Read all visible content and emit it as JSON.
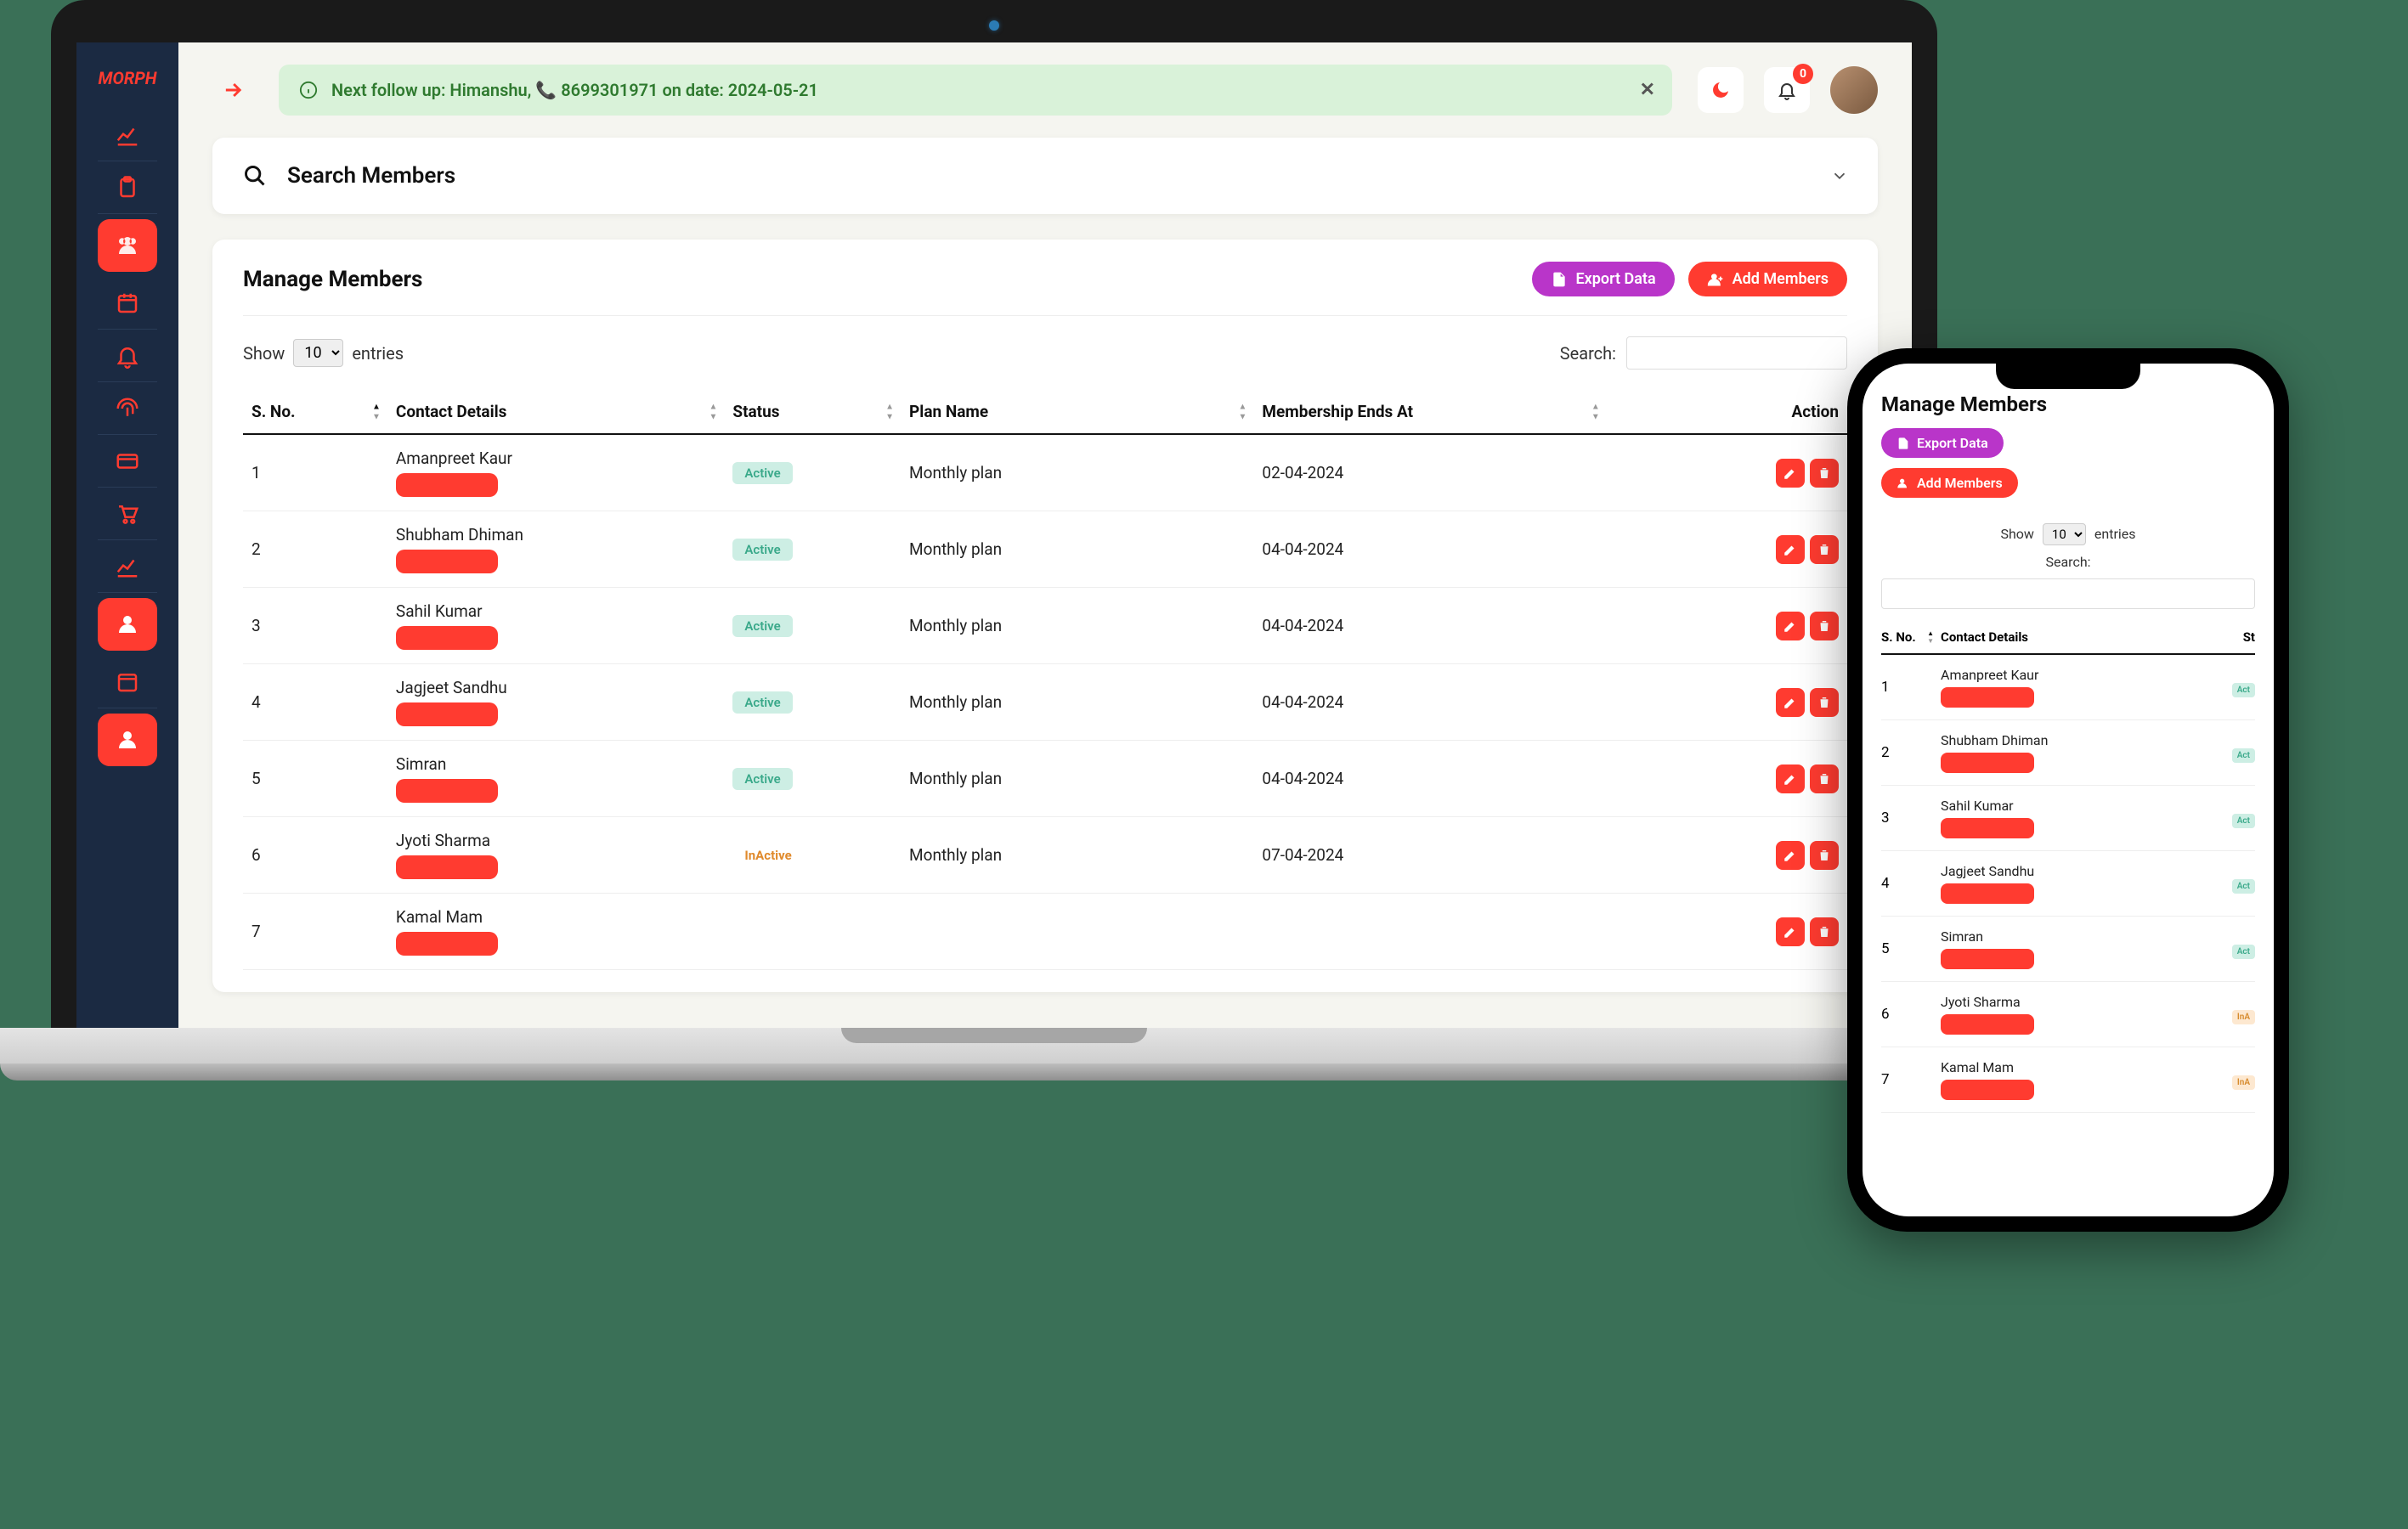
{
  "logo": "MORPH",
  "alert": {
    "text": "Next follow up: Himanshu, 📞 8699301971 on date: 2024-05-21"
  },
  "notifications": {
    "count": "0"
  },
  "search_card": {
    "title": "Search Members"
  },
  "manage": {
    "title": "Manage Members",
    "export_label": "Export Data",
    "add_label": "Add Members"
  },
  "table": {
    "show_prefix": "Show",
    "show_value": "10",
    "show_suffix": "entries",
    "search_label": "Search:",
    "columns": {
      "sno": "S. No.",
      "contact": "Contact Details",
      "status": "Status",
      "plan": "Plan Name",
      "ends": "Membership Ends At",
      "action": "Action"
    },
    "rows": [
      {
        "no": "1",
        "name": "Amanpreet Kaur",
        "status": "Active",
        "plan": "Monthly plan",
        "ends": "02-04-2024"
      },
      {
        "no": "2",
        "name": "Shubham Dhiman",
        "status": "Active",
        "plan": "Monthly plan",
        "ends": "04-04-2024"
      },
      {
        "no": "3",
        "name": "Sahil Kumar",
        "status": "Active",
        "plan": "Monthly plan",
        "ends": "04-04-2024"
      },
      {
        "no": "4",
        "name": "Jagjeet Sandhu",
        "status": "Active",
        "plan": "Monthly plan",
        "ends": "04-04-2024"
      },
      {
        "no": "5",
        "name": "Simran",
        "status": "Active",
        "plan": "Monthly plan",
        "ends": "04-04-2024"
      },
      {
        "no": "6",
        "name": "Jyoti Sharma",
        "status": "InActive",
        "plan": "Monthly plan",
        "ends": "07-04-2024"
      },
      {
        "no": "7",
        "name": "Kamal Mam",
        "status": "",
        "plan": "",
        "ends": ""
      }
    ]
  },
  "phone": {
    "title": "Manage Members",
    "export_label": "Export Data",
    "add_label": "Add Members",
    "show_prefix": "Show",
    "show_value": "10",
    "show_suffix": "entries",
    "search_label": "Search:",
    "columns": {
      "sno": "S. No.",
      "contact": "Contact Details",
      "status": "St"
    },
    "rows": [
      {
        "no": "1",
        "name": "Amanpreet Kaur",
        "status": "Act",
        "active": true
      },
      {
        "no": "2",
        "name": "Shubham Dhiman",
        "status": "Act",
        "active": true
      },
      {
        "no": "3",
        "name": "Sahil Kumar",
        "status": "Act",
        "active": true
      },
      {
        "no": "4",
        "name": "Jagjeet Sandhu",
        "status": "Act",
        "active": true
      },
      {
        "no": "5",
        "name": "Simran",
        "status": "Act",
        "active": true
      },
      {
        "no": "6",
        "name": "Jyoti Sharma",
        "status": "InA",
        "active": false
      },
      {
        "no": "7",
        "name": "Kamal Mam",
        "status": "InA",
        "active": false
      }
    ]
  }
}
